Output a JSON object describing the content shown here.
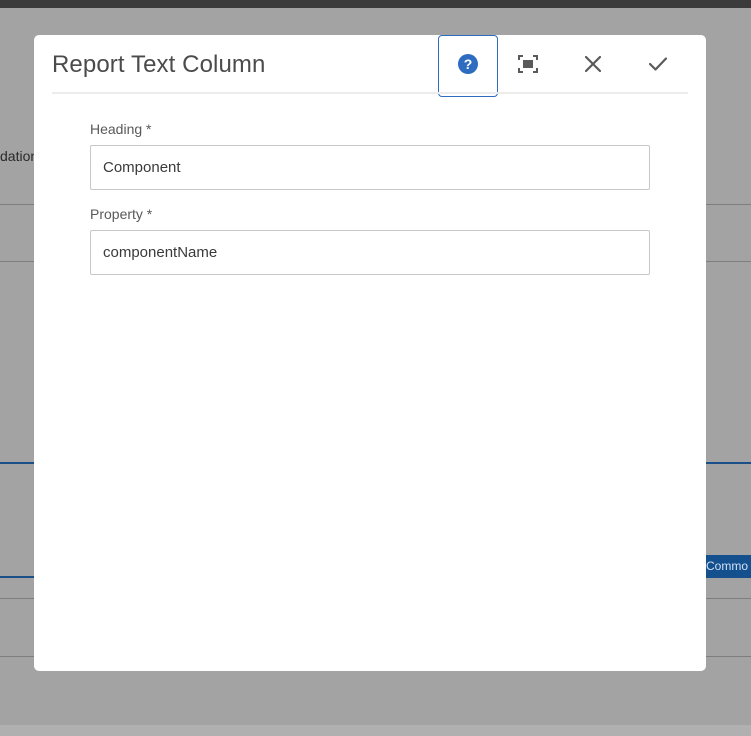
{
  "background": {
    "partial_text": "dation",
    "tag_label": "Commo"
  },
  "dialog": {
    "title": "Report Text Column",
    "toolbar": {
      "help_icon": "help-circle-icon",
      "fullscreen_icon": "fullscreen-icon",
      "close_icon": "close-icon",
      "done_icon": "checkmark-icon"
    },
    "fields": [
      {
        "label": "Heading *",
        "value": "Component"
      },
      {
        "label": "Property *",
        "value": "componentName"
      }
    ]
  },
  "colors": {
    "accent": "#2d6cc0",
    "overlay": "#a3a3a3",
    "icon": "#5a5a5a"
  }
}
